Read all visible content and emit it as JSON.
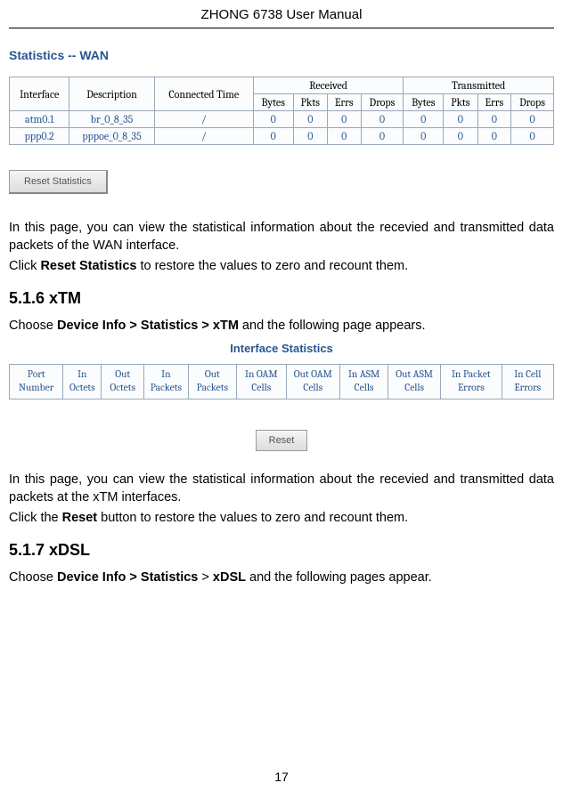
{
  "header": {
    "title": "ZHONG 6738 User Manual"
  },
  "wan": {
    "title": "Statistics -- WAN",
    "cols": {
      "interface": "Interface",
      "description": "Description",
      "connected": "Connected Time",
      "received": "Received",
      "transmitted": "Transmitted",
      "bytes": "Bytes",
      "pkts": "Pkts",
      "errs": "Errs",
      "drops": "Drops"
    },
    "rows": [
      {
        "iface": "atm0.1",
        "desc": "br_0_8_35",
        "conn": "/",
        "rB": "0",
        "rP": "0",
        "rE": "0",
        "rD": "0",
        "tB": "0",
        "tP": "0",
        "tE": "0",
        "tD": "0"
      },
      {
        "iface": "ppp0.2",
        "desc": "pppoe_0_8_35",
        "conn": "/",
        "rB": "0",
        "rP": "0",
        "rE": "0",
        "rD": "0",
        "tB": "0",
        "tP": "0",
        "tE": "0",
        "tD": "0"
      }
    ],
    "reset_label": "Reset Statistics"
  },
  "para": {
    "wan1": "In this page, you can view the statistical information about the recevied and transmitted data packets of the WAN interface.",
    "wan2a": "Click ",
    "wan2b": "Reset Statistics",
    "wan2c": " to restore the values to zero and recount them.",
    "xtm_head": "5.1.6    xTM",
    "xtm1a": "Choose ",
    "xtm1b": "Device Info > Statistics > xTM",
    "xtm1c": " and the following page appears.",
    "xtm2": "In this page, you can view the statistical information about the recevied and transmitted data packets at the xTM interfaces.",
    "xtm3a": "Click the ",
    "xtm3b": "Reset",
    "xtm3c": " button to restore the values to zero and recount them.",
    "xdsl_head": "5.1.7    xDSL",
    "xdsl1a": "Choose ",
    "xdsl1b": "Device Info > Statistics",
    "xdsl1c": " > ",
    "xdsl1d": "xDSL",
    "xdsl1e": " and the following pages appear."
  },
  "xtm": {
    "title": "Interface Statistics",
    "cols": [
      "Port Number",
      "In Octets",
      "Out Octets",
      "In Packets",
      "Out Packets",
      "In OAM Cells",
      "Out OAM Cells",
      "In ASM Cells",
      "Out ASM Cells",
      "In Packet Errors",
      "In Cell Errors"
    ],
    "reset_label": "Reset"
  },
  "page_number": "17"
}
